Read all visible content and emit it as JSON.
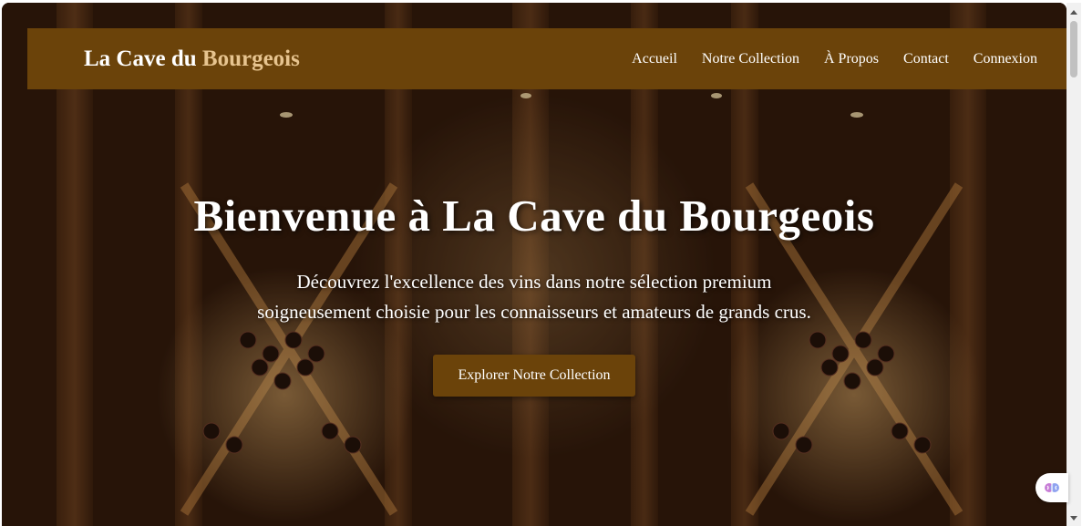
{
  "brand": {
    "name_part1": "La Cave du ",
    "name_part2": "Bourgeois"
  },
  "nav": {
    "items": [
      {
        "label": "Accueil"
      },
      {
        "label": "Notre Collection"
      },
      {
        "label": "À Propos"
      },
      {
        "label": "Contact"
      },
      {
        "label": "Connexion"
      }
    ]
  },
  "hero": {
    "title": "Bienvenue à La Cave du Bourgeois",
    "subtitle": "Découvrez l'excellence des vins dans notre sélection premium soigneusement choisie pour les connaisseurs et amateurs de grands crus.",
    "cta_label": "Explorer Notre Collection",
    "background_icon": "wine-cellar-image"
  },
  "widget": {
    "icon": "brain-icon"
  },
  "colors": {
    "navbar": "#6b430a",
    "brand_accent": "#e7c48f",
    "cta": "#6b430a",
    "text": "#ffffff"
  }
}
